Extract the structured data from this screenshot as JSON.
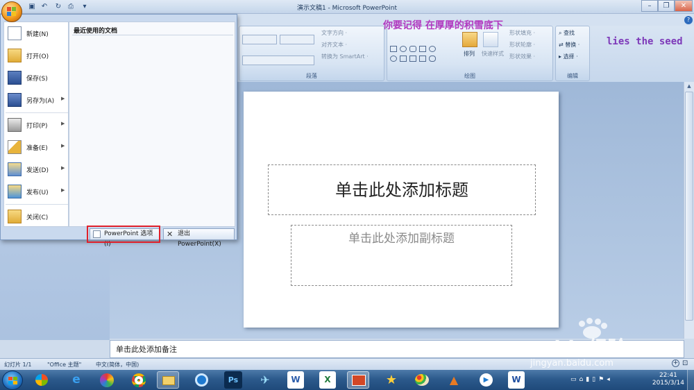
{
  "window": {
    "title": "演示文稿1 - Microsoft PowerPoint",
    "minimize": "–",
    "restore": "❐",
    "close": "✕"
  },
  "ribbon": {
    "groups": {
      "paragraph": "段落",
      "drawing": "绘图",
      "editing": "编辑"
    },
    "paragraph_items": [
      "文字方向 ·",
      "对齐文本 ·",
      "转换为 SmartArt ·"
    ],
    "drawing_buttons": [
      "排列",
      "快速样式"
    ],
    "drawing_items": [
      "形状填充 ·",
      "形状轮廓 ·",
      "形状效果 ·"
    ],
    "editing_items": [
      "查找",
      "替换 ·",
      "选择 ·"
    ]
  },
  "overlays": {
    "chinese": "你要记得 在厚厚的积雪底下",
    "english": "lies the seed"
  },
  "office_menu": {
    "items": [
      {
        "label": "新建(N)",
        "has_arrow": false,
        "icon": "new-document-icon"
      },
      {
        "label": "打开(O)",
        "has_arrow": false,
        "icon": "open-folder-icon"
      },
      {
        "label": "保存(S)",
        "has_arrow": false,
        "icon": "save-disk-icon"
      },
      {
        "label": "另存为(A)",
        "has_arrow": true,
        "icon": "save-as-icon"
      },
      {
        "label": "打印(P)",
        "has_arrow": true,
        "icon": "printer-icon"
      },
      {
        "label": "准备(E)",
        "has_arrow": true,
        "icon": "prepare-icon"
      },
      {
        "label": "发送(D)",
        "has_arrow": true,
        "icon": "send-icon"
      },
      {
        "label": "发布(U)",
        "has_arrow": true,
        "icon": "publish-icon"
      },
      {
        "label": "关闭(C)",
        "has_arrow": false,
        "icon": "close-folder-icon"
      }
    ],
    "recent_documents_title": "最近使用的文档",
    "options_button": "PowerPoint 选项(I)",
    "exit_button": "退出 PowerPoint(X)"
  },
  "slide": {
    "title_placeholder": "单击此处添加标题",
    "subtitle_placeholder": "单击此处添加副标题"
  },
  "notes": {
    "placeholder": "单击此处添加备注"
  },
  "statusbar": {
    "slide_count": "幻灯片 1/1",
    "theme": "\"Office 主题\"",
    "language": "中文(简体，中国)"
  },
  "taskbar": {
    "apps": [
      "windows-flag",
      "internet-explorer",
      "photo-viewer",
      "chrome",
      "file-explorer",
      "music-player",
      "photoshop",
      "bird-app",
      "word",
      "excel",
      "powerpoint",
      "star-app",
      "paint",
      "matlab",
      "video-player",
      "wps-writer"
    ],
    "clock_time": "22:41",
    "clock_date": "2015/3/14"
  },
  "watermark": {
    "brand": "Baidu经验",
    "url": "jingyan.baidu.com"
  },
  "colors": {
    "highlight_border": "#e0202a",
    "overlay_chinese": "#b23ac0",
    "overlay_english": "#7d39b9"
  }
}
